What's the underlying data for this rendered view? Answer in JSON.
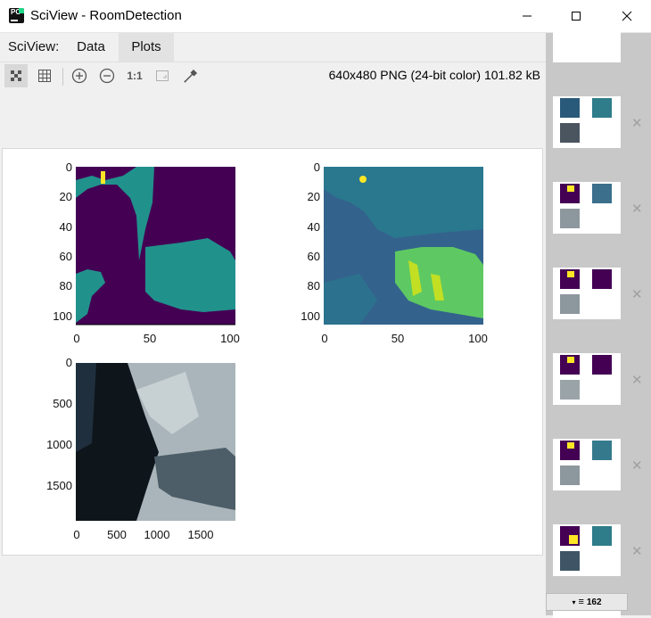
{
  "window": {
    "title": "SciView - RoomDetection"
  },
  "tabs": {
    "prefix": "SciView:",
    "data": "Data",
    "plots": "Plots"
  },
  "toolbar": {
    "image_info": "640x480 PNG (24-bit color) 101.82 kB",
    "ratio_label": "1:1"
  },
  "plot1": {
    "yticks": [
      "0",
      "20",
      "40",
      "60",
      "80",
      "100"
    ],
    "xticks": [
      "0",
      "50",
      "100"
    ]
  },
  "plot2": {
    "yticks": [
      "0",
      "20",
      "40",
      "60",
      "80",
      "100"
    ],
    "xticks": [
      "0",
      "50",
      "100"
    ]
  },
  "plot3": {
    "yticks": [
      "0",
      "500",
      "1000",
      "1500"
    ],
    "xticks": [
      "0",
      "500",
      "1000",
      "1500"
    ]
  },
  "sidebar": {
    "counter": "162"
  },
  "colors": {
    "viridis_purple": "#440154",
    "viridis_teal": "#21918c",
    "viridis_yellow": "#fde725"
  }
}
